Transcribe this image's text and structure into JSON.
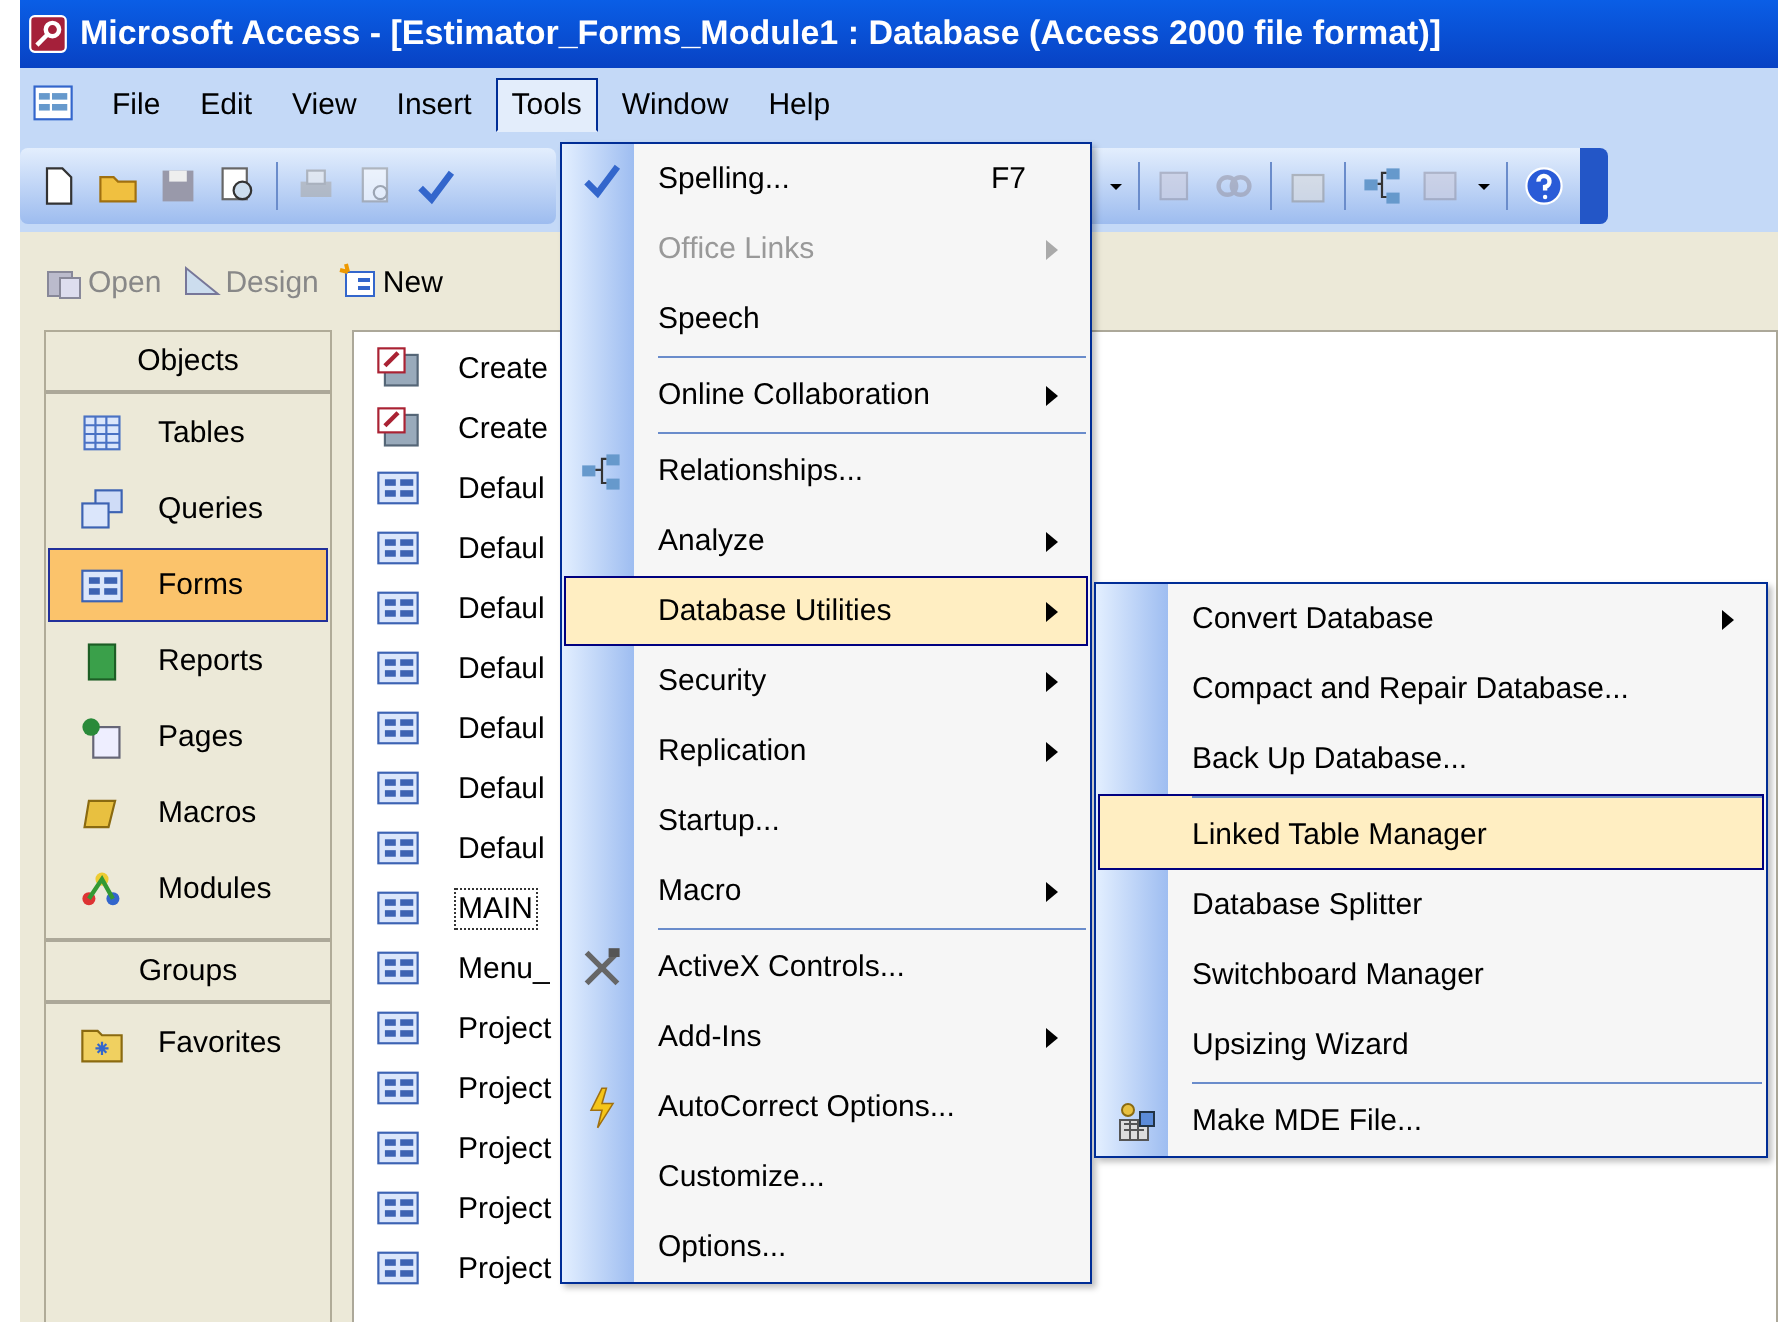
{
  "window": {
    "title": "Microsoft Access - [Estimator_Forms_Module1 : Database (Access 2000 file format)]"
  },
  "menu_bar": [
    {
      "label": "File",
      "selected": false
    },
    {
      "label": "Edit",
      "selected": false
    },
    {
      "label": "View",
      "selected": false
    },
    {
      "label": "Insert",
      "selected": false
    },
    {
      "label": "Tools",
      "selected": true
    },
    {
      "label": "Window",
      "selected": false
    },
    {
      "label": "Help",
      "selected": false
    }
  ],
  "db_toolbar": [
    "Open",
    "Design",
    "New"
  ],
  "objects": {
    "header": "Objects",
    "items": [
      {
        "label": "Tables",
        "selected": false
      },
      {
        "label": "Queries",
        "selected": false
      },
      {
        "label": "Forms",
        "selected": true
      },
      {
        "label": "Reports",
        "selected": false
      },
      {
        "label": "Pages",
        "selected": false
      },
      {
        "label": "Macros",
        "selected": false
      },
      {
        "label": "Modules",
        "selected": false
      }
    ],
    "groups_header": "Groups",
    "groups": [
      {
        "label": "Favorites",
        "selected": false
      }
    ]
  },
  "forms_list": [
    {
      "kind": "shortcut",
      "label": "Create",
      "focused": false
    },
    {
      "kind": "shortcut",
      "label": "Create",
      "focused": false
    },
    {
      "kind": "form",
      "label": "Defaul",
      "focused": false
    },
    {
      "kind": "form",
      "label": "Defaul",
      "focused": false
    },
    {
      "kind": "form",
      "label": "Defaul",
      "focused": false
    },
    {
      "kind": "form",
      "label": "Defaul",
      "focused": false
    },
    {
      "kind": "form",
      "label": "Defaul",
      "focused": false
    },
    {
      "kind": "form",
      "label": "Defaul",
      "focused": false
    },
    {
      "kind": "form",
      "label": "Defaul",
      "focused": false
    },
    {
      "kind": "form",
      "label": "MAIN",
      "focused": true
    },
    {
      "kind": "form",
      "label": "Menu_",
      "focused": false
    },
    {
      "kind": "form",
      "label": "Project",
      "focused": false
    },
    {
      "kind": "form",
      "label": "Project",
      "focused": false
    },
    {
      "kind": "form",
      "label": "Project",
      "focused": false
    },
    {
      "kind": "form",
      "label": "Project",
      "focused": false
    },
    {
      "kind": "form",
      "label": "Project",
      "focused": false
    }
  ],
  "tools_menu": [
    {
      "label": "Spelling...",
      "shortcut": "F7",
      "submenu": false,
      "disabled": false,
      "selected": false,
      "separator_before": false
    },
    {
      "label": "Office Links",
      "submenu": true,
      "disabled": true,
      "selected": false,
      "separator_before": false
    },
    {
      "label": "Speech",
      "submenu": false,
      "disabled": false,
      "selected": false,
      "separator_before": false
    },
    {
      "label": "Online Collaboration",
      "submenu": true,
      "disabled": false,
      "selected": false,
      "separator_before": true
    },
    {
      "label": "Relationships...",
      "submenu": false,
      "disabled": false,
      "selected": false,
      "separator_before": true
    },
    {
      "label": "Analyze",
      "submenu": true,
      "disabled": false,
      "selected": false,
      "separator_before": false
    },
    {
      "label": "Database Utilities",
      "submenu": true,
      "disabled": false,
      "selected": true,
      "separator_before": false
    },
    {
      "label": "Security",
      "submenu": true,
      "disabled": false,
      "selected": false,
      "separator_before": false
    },
    {
      "label": "Replication",
      "submenu": true,
      "disabled": false,
      "selected": false,
      "separator_before": false
    },
    {
      "label": "Startup...",
      "submenu": false,
      "disabled": false,
      "selected": false,
      "separator_before": false
    },
    {
      "label": "Macro",
      "submenu": true,
      "disabled": false,
      "selected": false,
      "separator_before": false
    },
    {
      "label": "ActiveX Controls...",
      "submenu": false,
      "disabled": false,
      "selected": false,
      "separator_before": true
    },
    {
      "label": "Add-Ins",
      "submenu": true,
      "disabled": false,
      "selected": false,
      "separator_before": false
    },
    {
      "label": "AutoCorrect Options...",
      "submenu": false,
      "disabled": false,
      "selected": false,
      "separator_before": false
    },
    {
      "label": "Customize...",
      "submenu": false,
      "disabled": false,
      "selected": false,
      "separator_before": false
    },
    {
      "label": "Options...",
      "submenu": false,
      "disabled": false,
      "selected": false,
      "separator_before": false
    }
  ],
  "utilities_submenu": [
    {
      "label": "Convert Database",
      "submenu": true,
      "selected": false,
      "separator_before": false
    },
    {
      "label": "Compact and Repair Database...",
      "submenu": false,
      "selected": false,
      "separator_before": false
    },
    {
      "label": "Back Up Database...",
      "submenu": false,
      "selected": false,
      "separator_before": false
    },
    {
      "label": "Linked Table Manager",
      "submenu": false,
      "selected": true,
      "separator_before": true
    },
    {
      "label": "Database Splitter",
      "submenu": false,
      "selected": false,
      "separator_before": false
    },
    {
      "label": "Switchboard Manager",
      "submenu": false,
      "selected": false,
      "separator_before": false
    },
    {
      "label": "Upsizing Wizard",
      "submenu": false,
      "selected": false,
      "separator_before": false
    },
    {
      "label": "Make MDE File...",
      "submenu": false,
      "selected": false,
      "separator_before": true
    }
  ]
}
